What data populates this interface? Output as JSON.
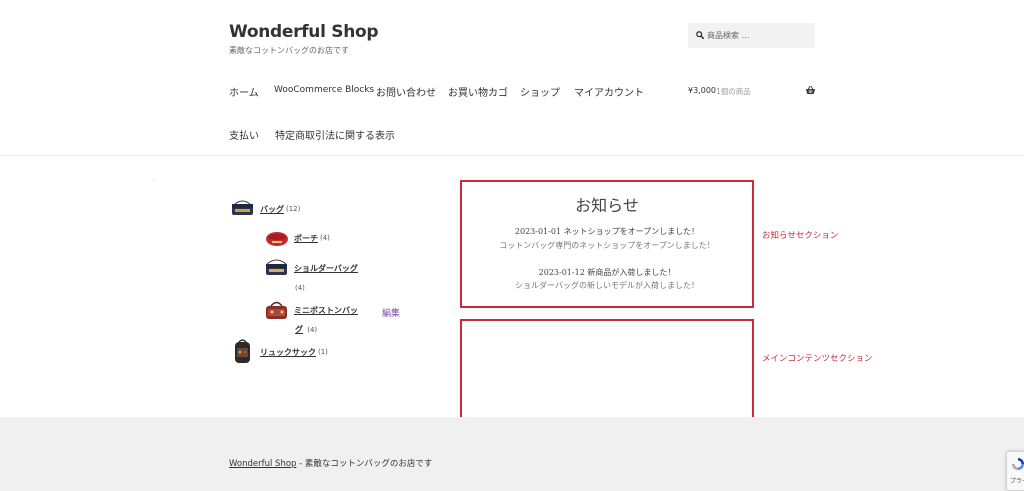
{
  "header": {
    "site_title": "Wonderful Shop",
    "site_description": "素敵なコットンバッグのお店です",
    "search_placeholder": "商品検索 …"
  },
  "nav": {
    "items": [
      {
        "label": "ホーム"
      },
      {
        "label": "WooCommerce Blocks"
      },
      {
        "label": "お問い合わせ"
      },
      {
        "label": "お買い物カゴ"
      },
      {
        "label": "ショップ"
      },
      {
        "label": "マイアカウント"
      },
      {
        "label": "支払い"
      },
      {
        "label": "特定商取引法に関する表示"
      }
    ]
  },
  "cart": {
    "amount": "¥3,000",
    "count_text": "1個の商品"
  },
  "dot": ".",
  "categories": [
    {
      "name": "バッグ",
      "count": "(12)"
    },
    {
      "name": "ポーチ",
      "count": "(4)"
    },
    {
      "name": "ショルダーバッグ",
      "count": "(4)"
    },
    {
      "name_line1": "ミニボストンバッ",
      "name_line2": "グ",
      "count": "(4)"
    },
    {
      "name": "リュックサック",
      "count": "(1)"
    }
  ],
  "edit_label": "編集",
  "notice": {
    "title": "お知らせ",
    "entries": [
      {
        "headline": "2023-01-01 ネットショップをオープンしました！",
        "detail": "コットンバッグ専門のネットショップをオープンしました！"
      },
      {
        "headline": "2023-01-12 新商品が入荷しました！",
        "detail": "ショルダーバッグの新しいモデルが入荷しました！"
      }
    ]
  },
  "annotations": {
    "notice_section": "お知らせセクション",
    "main_content_section": "メインコンテンツセクション"
  },
  "footer": {
    "site_link": "Wonderful Shop",
    "tagline": " - 素敵なコットンバッグのお店です"
  },
  "recaptcha": {
    "text": "プライバ"
  },
  "colors": {
    "annotation_red": "#c72c3a",
    "edit_purple": "#7d4b9e",
    "footer_bg": "#f0f0f0"
  }
}
